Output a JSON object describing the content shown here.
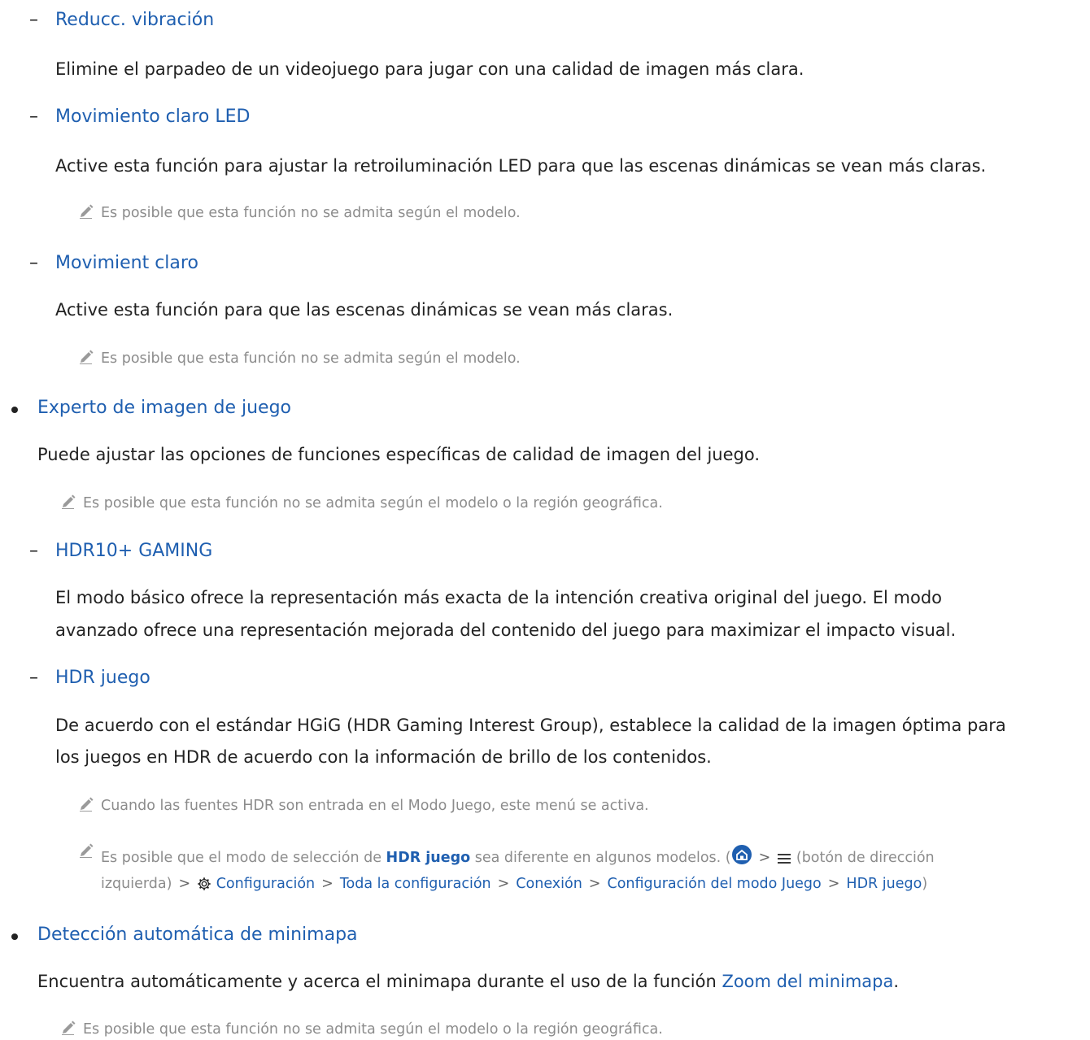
{
  "items": {
    "reducc_title": "Reducc. vibración",
    "reducc_body": "Elimine el parpadeo de un videojuego para jugar con una calidad de imagen más clara.",
    "led_title": "Movimiento claro LED",
    "led_body": "Active esta función para ajustar la retroiluminación LED para que las escenas dinámicas se vean más claras.",
    "led_note": "Es posible que esta función no se admita según el modelo.",
    "mov_title": "Movimient claro",
    "mov_body": "Active esta función para que las escenas dinámicas se vean más claras.",
    "mov_note": "Es posible que esta función no se admita según el modelo.",
    "expert_title": "Experto de imagen de juego",
    "expert_body": "Puede ajustar las opciones de funciones específicas de calidad de imagen del juego.",
    "expert_note": "Es posible que esta función no se admita según el modelo o la región geográfica.",
    "hdr10_title": "HDR10+ GAMING",
    "hdr10_body_1": "El modo básico ofrece la representación más exacta de la intención creativa original del juego. El modo",
    "hdr10_body_2": "avanzado ofrece una representación mejorada del contenido del juego para maximizar el impacto visual.",
    "hdrj_title": "HDR juego",
    "hdrj_body_1": "De acuerdo con el estándar HGiG (HDR Gaming Interest Group), establece la calidad de la imagen óptima para",
    "hdrj_body_2": "los juegos en HDR de acuerdo con la información de brillo de los contenidos.",
    "hdrj_note1": "Cuando las fuentes HDR son entrada en el Modo Juego, este menú se activa.",
    "hdrj_note2_a": "Es posible que el modo de selección de ",
    "hdrj_note2_b": "HDR juego",
    "hdrj_note2_c": " sea diferente en algunos modelos. (",
    "hdrj_note2_d": "(botón de dirección",
    "path_left": "izquierda)",
    "path_1": "Configuración",
    "path_2": "Toda la configuración",
    "path_3": "Conexión",
    "path_4": "Configuración del modo Juego",
    "path_5": "HDR juego",
    "path_close": ")",
    "mini_title": "Detección automática de minimapa",
    "mini_body_a": "Encuentra automáticamente y acerca el minimapa durante el uso de la función ",
    "mini_body_b": "Zoom del minimapa",
    "mini_body_c": ".",
    "mini_note": "Es posible que esta función no se admita según el modelo o la región geográfica."
  },
  "colors": {
    "link": "#1f5fb0",
    "note": "#8c8c8c",
    "text": "#222222"
  },
  "symbols": {
    "dash": "–",
    "arrow": ">"
  }
}
